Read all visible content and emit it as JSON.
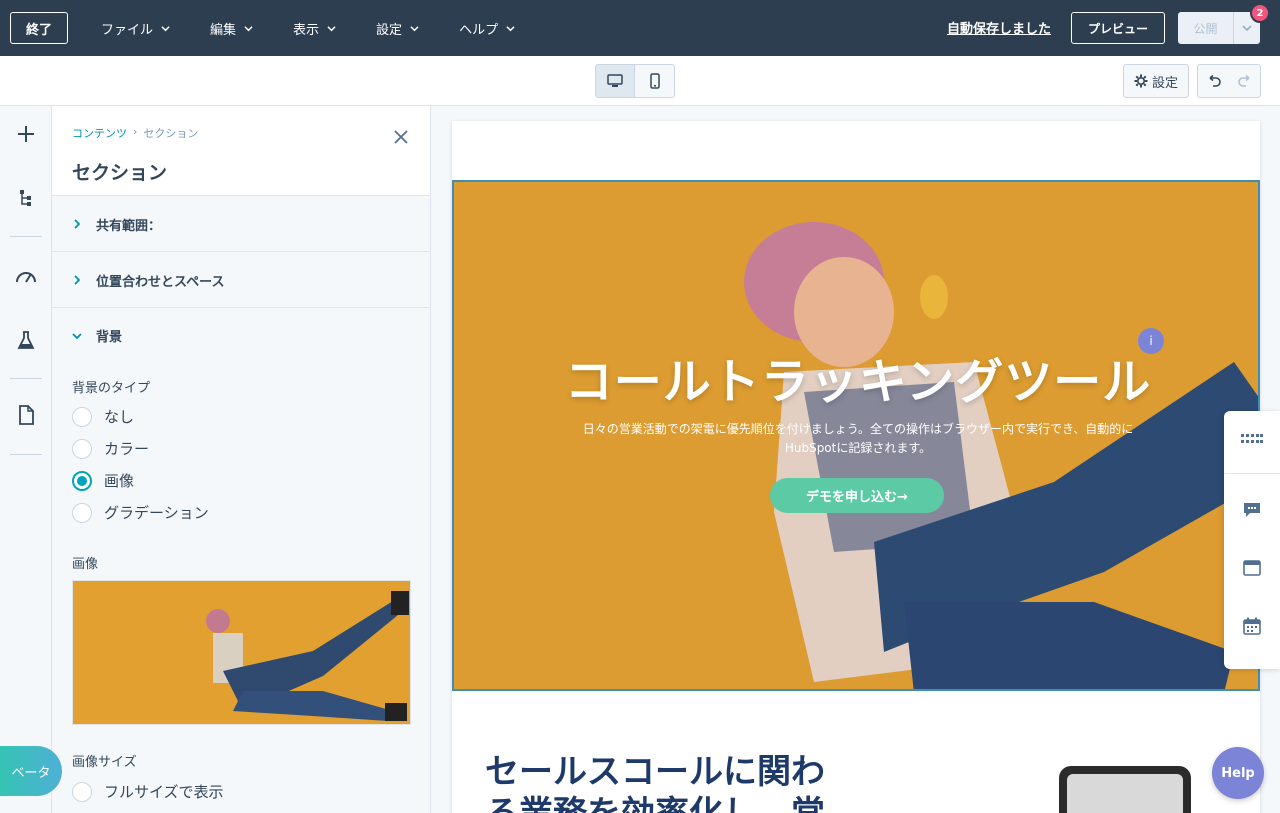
{
  "topbar": {
    "exit_label": "終了",
    "menu": [
      {
        "label": "ファイル"
      },
      {
        "label": "編集"
      },
      {
        "label": "表示"
      },
      {
        "label": "設定"
      },
      {
        "label": "ヘルプ"
      }
    ],
    "autosave_text": "自動保存しました",
    "preview_label": "プレビュー",
    "publish_label": "公開",
    "notification_count": "2"
  },
  "toolbar": {
    "settings_label": "設定"
  },
  "panel": {
    "breadcrumb_parent": "コンテンツ",
    "breadcrumb_sep": "›",
    "breadcrumb_current": "セクション",
    "title": "セクション",
    "accordions": [
      {
        "label": "共有範囲："
      },
      {
        "label": "位置合わせとスペース"
      },
      {
        "label": "背景"
      }
    ],
    "background_type_label": "背景のタイプ",
    "background_options": [
      {
        "label": "なし",
        "selected": false
      },
      {
        "label": "カラー",
        "selected": false
      },
      {
        "label": "画像",
        "selected": true
      },
      {
        "label": "グラデーション",
        "selected": false
      }
    ],
    "image_label": "画像",
    "image_size_label": "画像サイズ",
    "image_size_option": "フルサイズで表示"
  },
  "canvas": {
    "hero_title": "コールトラッキングツール",
    "hero_subtitle_line1": "日々の営業活動での架電に優先順位を付けましょう。全ての操作はブラウザー内で実行でき、自動的に",
    "hero_subtitle_line2": "HubSpotに記録されます。",
    "hero_cta": "デモを申し込む→",
    "info_badge": "i",
    "section2_title": "セールスコールに関わる業務を効率化し、常"
  },
  "beta_label": "ベータ",
  "help_label": "Help",
  "colors": {
    "topbar_bg": "#2d3e50",
    "accent": "#00a4bd",
    "hero_bg": "#dc9c31",
    "cta": "#5ccaa5",
    "notification": "#f2547d",
    "help": "#7b84d6"
  },
  "icons": {
    "rail": [
      "plus-icon",
      "tree-icon",
      "gauge-icon",
      "flask-icon",
      "document-icon"
    ],
    "right_tools": [
      "grid-icon",
      "comment-icon",
      "window-icon",
      "calendar-icon"
    ]
  }
}
